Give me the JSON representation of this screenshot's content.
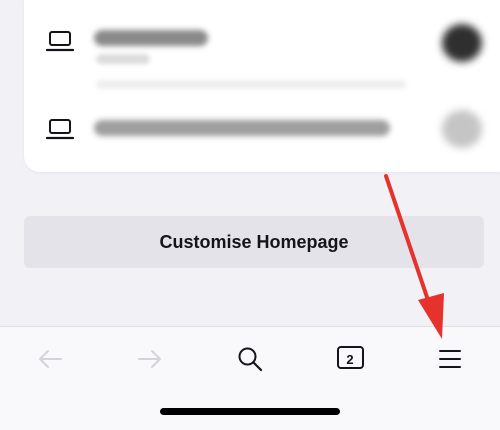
{
  "recent_synced_tabs": {
    "items": [
      {
        "icon": "laptop-icon"
      },
      {
        "icon": "laptop-icon"
      }
    ]
  },
  "customise_button": {
    "label": "Customise Homepage"
  },
  "toolbar": {
    "tab_count": "2",
    "back_icon": "arrow-left-icon",
    "forward_icon": "arrow-right-icon",
    "search_icon": "search-icon",
    "tabs_icon": "tabs-icon",
    "menu_icon": "menu-icon"
  },
  "colors": {
    "background": "#f2f1f6",
    "card": "#ffffff",
    "button": "#e4e3e9",
    "annotation_arrow": "#e5322d"
  }
}
